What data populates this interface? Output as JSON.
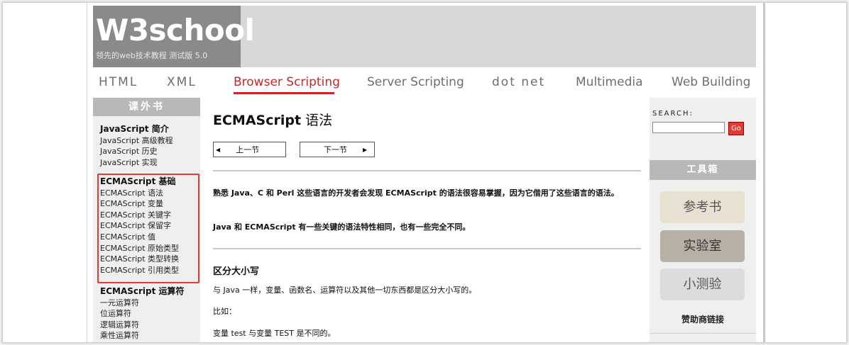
{
  "logo": {
    "title": "W3school",
    "subtitle": "领先的web技术教程 测试版 5.0"
  },
  "nav": [
    "HTML",
    "XML",
    "Browser Scripting",
    "Server Scripting",
    "dot net",
    "Multimedia",
    "Web Building"
  ],
  "nav_active": "Browser Scripting",
  "sidebar": {
    "title": "课外书",
    "group1": {
      "title": "JavaScript 简介",
      "items": [
        "JavaScript 高级教程",
        "JavaScript 历史",
        "JavaScript 实现"
      ]
    },
    "group2": {
      "title": "ECMAScript 基础",
      "items": [
        "ECMAScript 语法",
        "ECMAScript 变量",
        "ECMAScript 关键字",
        "ECMAScript 保留字",
        "ECMAScript 值",
        "ECMAScript 原始类型",
        "ECMAScript 类型转换",
        "ECMAScript 引用类型"
      ]
    },
    "group3": {
      "title": "ECMAScript 运算符",
      "items": [
        "一元运算符",
        "位运算符",
        "逻辑运算符",
        "乘性运算符"
      ]
    }
  },
  "main": {
    "heading_bold": "ECMAScript",
    "heading_rest": " 语法",
    "prev_label": "上一节",
    "next_label": "下一节",
    "para1": "熟悉 Java、C 和 Perl 这些语言的开发者会发现 ECMAScript 的语法很容易掌握，因为它借用了这些语言的语法。",
    "para2": "Java 和 ECMAScript 有一些关键的语法特性相同，也有一些完全不同。",
    "section_title": "区分大小写",
    "para3": "与 Java 一样，变量、函数名、运算符以及其他一切东西都是区分大小写的。",
    "para4": "比如：",
    "para5": "变量 test 与变量 TEST 是不同的。"
  },
  "right": {
    "search_label": "SEARCH:",
    "go_label": "Go",
    "toolbox_title": "工具箱",
    "tool1": "参考书",
    "tool2": "实验室",
    "tool3": "小测验",
    "sponsor": "赞助商链接"
  }
}
